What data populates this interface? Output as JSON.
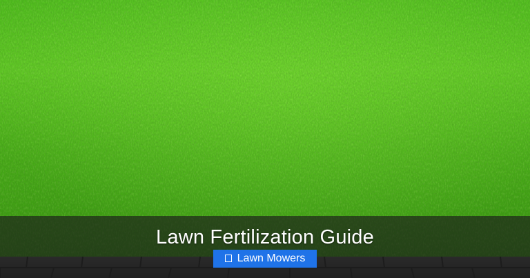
{
  "post": {
    "title": "Lawn Fertilization Guide",
    "category": {
      "icon": "category-icon",
      "label": "Lawn Mowers"
    }
  },
  "background": {
    "image": "green-lawn-photo",
    "colors": {
      "grass_light": "#6fd12c",
      "grass_mid": "#44a714",
      "grass_dark": "#2c7a0c",
      "pavers": "#3a3a3a"
    }
  },
  "colors": {
    "badge": "#1f73e8",
    "overlay": "#1c1c1c",
    "text": "#ffffff"
  }
}
